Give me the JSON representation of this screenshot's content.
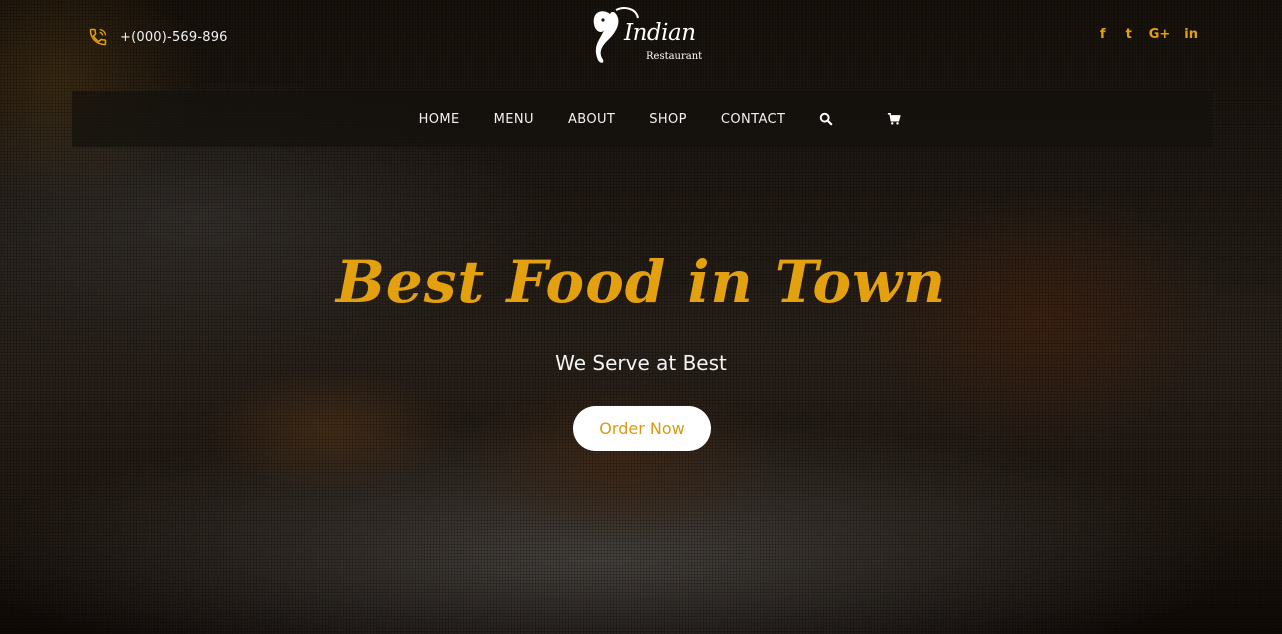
{
  "header": {
    "phone": "+(000)-569-896",
    "logo": {
      "word": "Indian",
      "sub": "Restaurant"
    },
    "social": [
      "f",
      "t",
      "G+",
      "in"
    ]
  },
  "nav": {
    "items": [
      "HOME",
      "MENU",
      "ABOUT",
      "SHOP",
      "CONTACT"
    ],
    "icons": [
      "search-icon",
      "cart-icon"
    ]
  },
  "hero": {
    "title": "Best Food in Town",
    "subtitle": "We Serve at Best",
    "cta": "Order Now"
  },
  "colors": {
    "accent": "#e4a10f",
    "nav_bg": "#14100c",
    "button_bg": "#ffffff"
  }
}
